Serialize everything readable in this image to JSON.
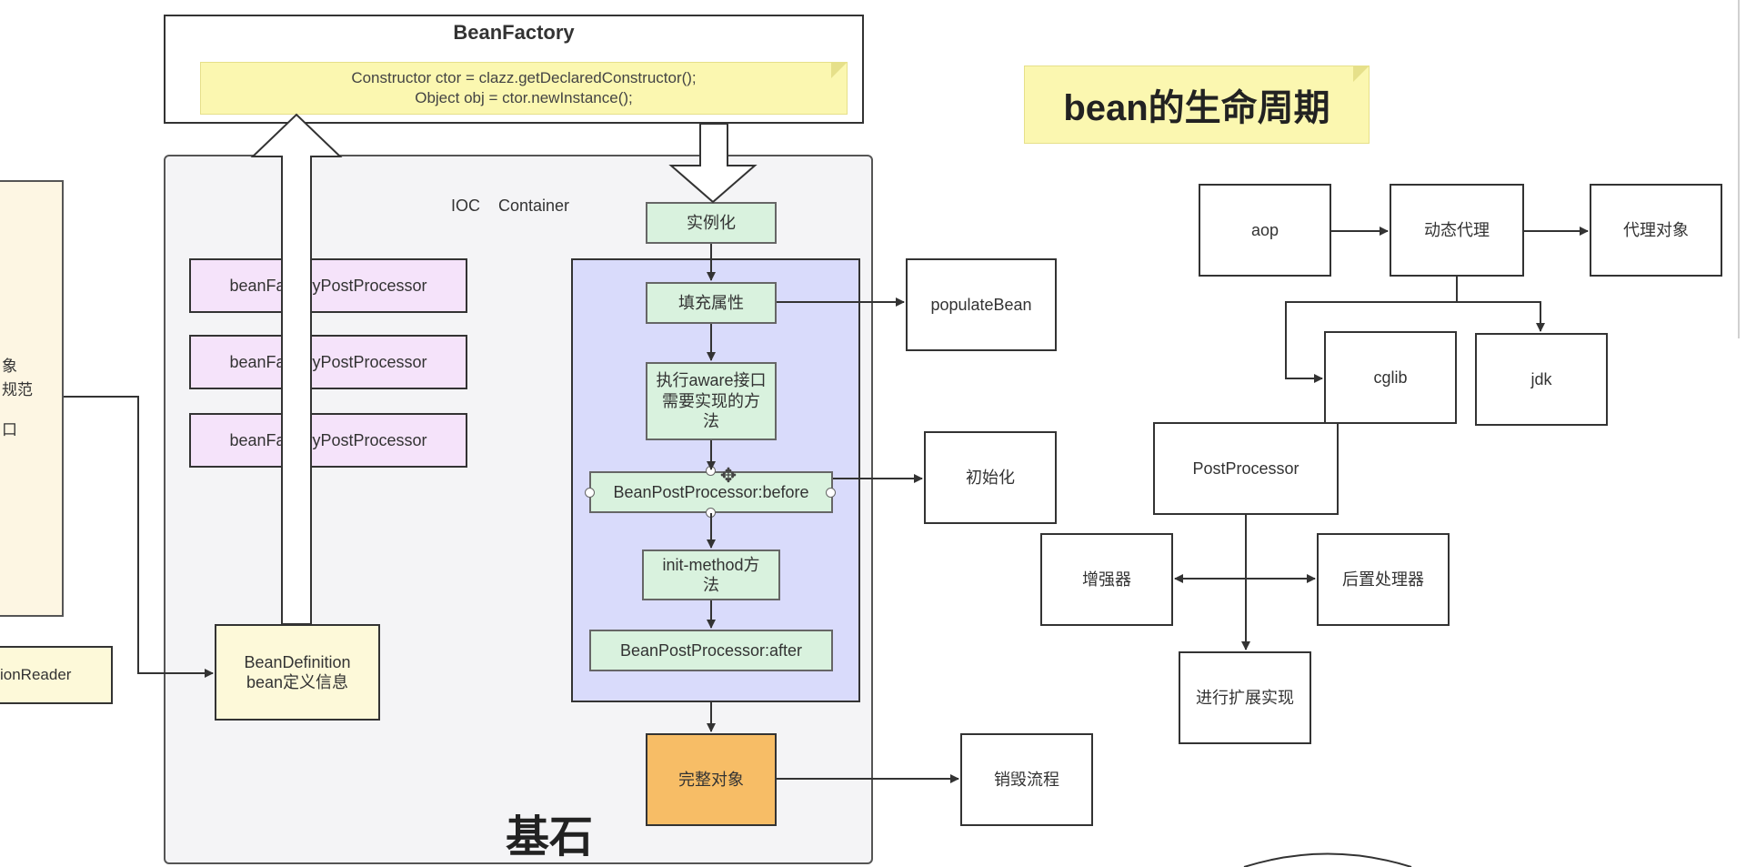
{
  "bean_factory": {
    "title": "BeanFactory",
    "code_line1": "Constructor ctor = clazz.getDeclaredConstructor();",
    "code_line2": "Object obj = ctor.newInstance();"
  },
  "lifecycle_title": "bean的生命周期",
  "ioc_container": {
    "label": "IOC    Container",
    "foundation_label": "基石",
    "post_processors": [
      "beanFactoryPostProcessor",
      "beanFactoryPostProcessor",
      "beanFactoryPostProcessor"
    ],
    "bean_definition": {
      "line1": "BeanDefinition",
      "line2": "bean定义信息"
    }
  },
  "left_panel": {
    "lines": [
      "象",
      "规范",
      "",
      "口"
    ],
    "reader_label": "ionReader"
  },
  "flow": {
    "instantiate": "实例化",
    "populate": "填充属性",
    "aware": "执行aware接口需要实现的方法",
    "bpp_before": "BeanPostProcessor:before",
    "init_method": "init-method方法",
    "bpp_after": "BeanPostProcessor:after",
    "complete": "完整对象"
  },
  "side": {
    "populate_bean": "populateBean",
    "init": "初始化",
    "destroy": "销毁流程"
  },
  "aop": {
    "aop": "aop",
    "dynamic_proxy": "动态代理",
    "proxy_object": "代理对象",
    "cglib": "cglib",
    "jdk": "jdk",
    "post_processor": "PostProcessor",
    "enhancer": "增强器",
    "post_handler": "后置处理器",
    "extension": "进行扩展实现"
  },
  "colors": {
    "purple_box": "#f5e3fa",
    "green_box": "#d9f2de",
    "blue_region": "#d9dbfb",
    "orange_box": "#f7bd66",
    "yellow_note": "#fbf7b0"
  }
}
